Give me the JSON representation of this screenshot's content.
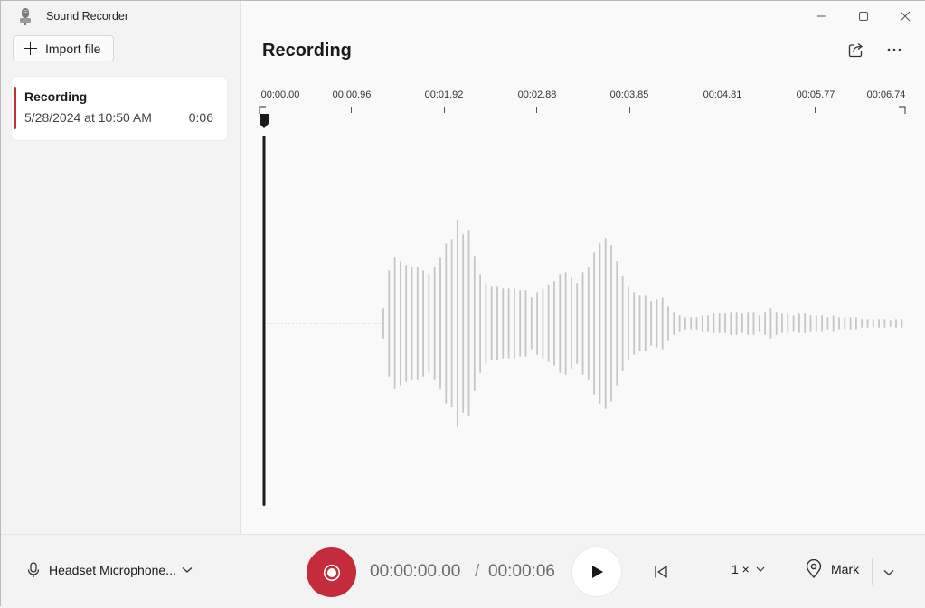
{
  "app": {
    "title": "Sound Recorder",
    "icon": "microphone-app-icon"
  },
  "sidebar": {
    "import_label": "Import file",
    "recordings": [
      {
        "name": "Recording",
        "date": "5/28/2024 at 10:50 AM",
        "duration": "0:06",
        "selected": true
      }
    ]
  },
  "main": {
    "title": "Recording",
    "timeline": {
      "ticks": [
        "00:00.00",
        "00:00.96",
        "00:01.92",
        "00:02.88",
        "00:03.85",
        "00:04.81",
        "00:05.77",
        "00:06.74"
      ]
    }
  },
  "player": {
    "input_device": "Headset Microphone...",
    "current_time": "00:00:00.00",
    "separator": "/",
    "total_time": "00:00:06",
    "speed": "1 ×",
    "mark_label": "Mark"
  },
  "colors": {
    "accent": "#c42b3b",
    "waveform": "#c6c6c6"
  }
}
